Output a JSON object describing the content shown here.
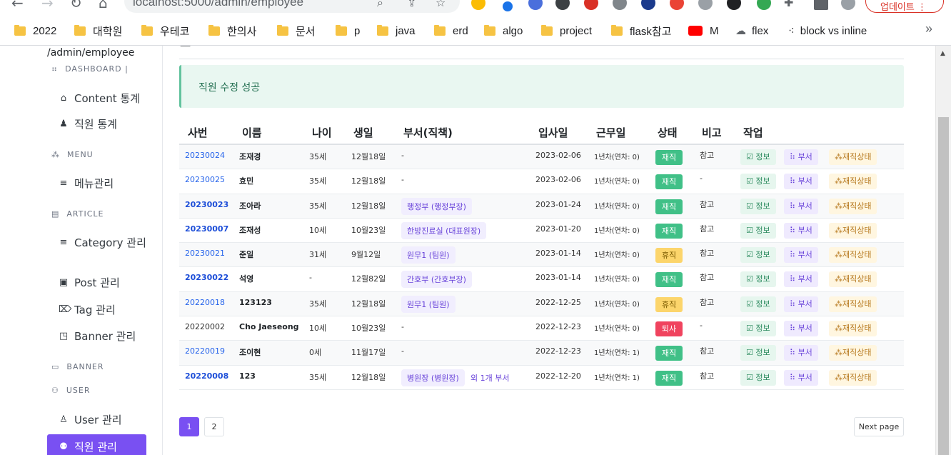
{
  "browser": {
    "url": "localhost:5000/admin/employee",
    "update_label": "업데이트",
    "bookmarks": [
      "2022",
      "대학원",
      "우테코",
      "한의사",
      "문서",
      "p",
      "java",
      "erd",
      "algo",
      "project",
      "flask참고",
      "M",
      "flex",
      "block vs inline"
    ],
    "bookmarks_more": "»"
  },
  "sidebar": {
    "path": "/admin/employee",
    "sections": {
      "dashboard": "DASHBOARD |",
      "menu": "MENU",
      "article": "ARTICLE",
      "banner": "BANNER",
      "user": "USER"
    },
    "items": {
      "content_stats": "Content 통계",
      "employee_stats": "직원 통계",
      "menu_manage": "메뉴관리",
      "category_manage": "Category 관리",
      "post_manage": "Post 관리",
      "tag_manage": "Tag 관리",
      "banner_manage": "Banner 관리",
      "user_manage": "User 관리",
      "employee_manage": "직원 관리"
    }
  },
  "main": {
    "alert": "직원 수정 성공",
    "headers": [
      "사번",
      "이름",
      "나이",
      "생일",
      "부서(직책)",
      "입사일",
      "근무일",
      "상태",
      "비고",
      "작업"
    ],
    "action_labels": {
      "info": "정보",
      "dept": "부서",
      "status": "재직상태"
    },
    "rows": [
      {
        "id": "20230024",
        "name": "조재경",
        "age": "35세",
        "birthday": "12월18일",
        "dept": "-",
        "extra": "",
        "hired": "2023-02-06",
        "tenure": "1년차(연차: 0)",
        "status": "재직",
        "note": "참고"
      },
      {
        "id": "20230025",
        "name": "효민",
        "age": "35세",
        "birthday": "12월18일",
        "dept": "-",
        "extra": "",
        "hired": "2023-02-06",
        "tenure": "1년차(연차: 0)",
        "status": "재직",
        "note": "-"
      },
      {
        "id": "20230023",
        "name": "조아라",
        "age": "35세",
        "birthday": "12월18일",
        "dept": "행정부 (행정부장)",
        "extra": "",
        "hired": "2023-01-24",
        "tenure": "1년차(연차: 0)",
        "status": "재직",
        "note": "참고"
      },
      {
        "id": "20230007",
        "name": "조재성",
        "age": "10세",
        "birthday": "10월23일",
        "dept": "한방진료실 (대표원장)",
        "extra": "",
        "hired": "2023-01-20",
        "tenure": "1년차(연차: 0)",
        "status": "재직",
        "note": "참고"
      },
      {
        "id": "20230021",
        "name": "준일",
        "age": "31세",
        "birthday": "9월12일",
        "dept": "원무1 (팀원)",
        "extra": "",
        "hired": "2023-01-14",
        "tenure": "1년차(연차: 0)",
        "status": "휴직",
        "note": "참고"
      },
      {
        "id": "20230022",
        "name": "석영",
        "age": "-",
        "birthday": "12월82일",
        "dept": "간호부 (간호부장)",
        "extra": "",
        "hired": "2023-01-14",
        "tenure": "1년차(연차: 0)",
        "status": "재직",
        "note": "참고"
      },
      {
        "id": "20220018",
        "name": "123123",
        "age": "35세",
        "birthday": "12월18일",
        "dept": "원무1 (팀원)",
        "extra": "",
        "hired": "2022-12-25",
        "tenure": "1년차(연차: 0)",
        "status": "휴직",
        "note": "참고"
      },
      {
        "id": "20220002",
        "name": "Cho Jaeseong",
        "age": "10세",
        "birthday": "10월23일",
        "dept": "-",
        "extra": "",
        "hired": "2022-12-23",
        "tenure": "1년차(연차: 0)",
        "status": "퇴사",
        "note": "-"
      },
      {
        "id": "20220019",
        "name": "조이현",
        "age": "0세",
        "birthday": "11월17일",
        "dept": "-",
        "extra": "",
        "hired": "2022-12-23",
        "tenure": "1년차(연차: 1)",
        "status": "재직",
        "note": "참고"
      },
      {
        "id": "20220008",
        "name": "123",
        "age": "35세",
        "birthday": "12월18일",
        "dept": "병원장 (병원장)",
        "extra": "외 1개 부서",
        "hired": "2022-12-20",
        "tenure": "1년차(연차: 1)",
        "status": "재직",
        "note": "참고"
      }
    ],
    "pages": [
      "1",
      "2"
    ],
    "next_page": "Next page"
  },
  "colors": {
    "accent": "#7950f2",
    "status_active": "#40c087",
    "status_leave": "#fcd56b",
    "status_resigned": "#f0435e"
  }
}
